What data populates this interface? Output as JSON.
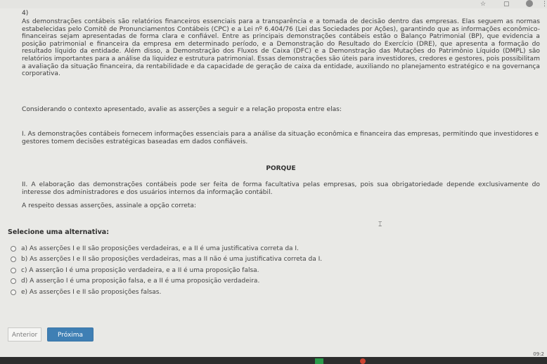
{
  "question": {
    "number": "4)",
    "intro": "As demonstrações contábeis são relatórios financeiros essenciais para a transparência e a tomada de decisão dentro das empresas. Elas seguem as normas estabelecidas pelo Comitê de Pronunciamentos Contábeis (CPC) e a Lei nº 6.404/76 (Lei das Sociedades por Ações), garantindo que as informações econômico-financeiras sejam apresentadas de forma clara e confiável. Entre as principais demonstrações contábeis estão o Balanço Patrimonial (BP), que evidencia a posição patrimonial e financeira da empresa em determinado período, e a Demonstração do Resultado do Exercício (DRE), que apresenta a formação do resultado líquido da entidade. Além disso, a Demonstração dos Fluxos de Caixa (DFC) e a Demonstração das Mutações do Patrimônio Líquido (DMPL) são relatórios importantes para a análise da liquidez e estrutura patrimonial. Essas demonstrações são úteis para investidores, credores e gestores, pois possibilitam a avaliação da situação financeira, da rentabilidade e da capacidade de geração de caixa da entidade, auxiliando no planejamento estratégico e na governança corporativa.",
    "consider": "Considerando o contexto apresentado, avalie as asserções a seguir e a relação proposta entre elas:",
    "assertion1": "I. As demonstrações contábeis fornecem informações essenciais para a análise da situação econômica e financeira das empresas, permitindo que investidores e gestores tomem decisões estratégicas baseadas em dados confiáveis.",
    "connector": "PORQUE",
    "assertion2": "II. A elaboração das demonstrações contábeis pode ser feita de forma facultativa pelas empresas, pois sua obrigatoriedade depende exclusivamente do interesse dos administradores e dos usuários internos da informação contábil.",
    "prompt": "A respeito dessas asserções, assinale a opção correta:"
  },
  "select_label": "Selecione uma alternativa:",
  "options": [
    "a) As asserções I e II são proposições verdadeiras, e a II é uma justificativa correta da I.",
    "b) As asserções I e II são proposições verdadeiras, mas a II não é uma justificativa correta da I.",
    "c) A asserção I é uma proposição verdadeira, e a II é uma proposição falsa.",
    "d) A asserção I é uma proposição falsa, e a II é uma proposição verdadeira.",
    "e) As asserções I e II são proposições falsas."
  ],
  "nav": {
    "prev_label": "Anterior",
    "next_label": "Próxima"
  },
  "taskbar": {
    "time": "09:2"
  },
  "colors": {
    "background": "#e9e9e6",
    "next_button": "#3f7fb4",
    "text": "#3c3c3c"
  }
}
